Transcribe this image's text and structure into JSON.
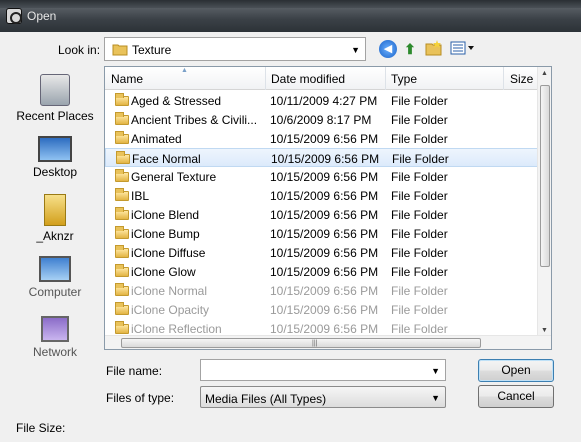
{
  "window": {
    "title": "Open"
  },
  "toolbar": {
    "look_in_label": "Look in:",
    "look_in_value": "Texture",
    "icons": [
      "back-icon",
      "up-folder-icon",
      "new-folder-icon",
      "views-menu-icon"
    ]
  },
  "places": [
    {
      "label": "Recent Places",
      "icon": "recent-places-icon"
    },
    {
      "label": "Desktop",
      "icon": "desktop-icon"
    },
    {
      "label": "_Aknzr",
      "icon": "user-folder-icon"
    },
    {
      "label": "Computer",
      "icon": "computer-icon"
    },
    {
      "label": "Network",
      "icon": "network-icon"
    }
  ],
  "columns": {
    "name": "Name",
    "date": "Date modified",
    "type": "Type",
    "size": "Size"
  },
  "files": [
    {
      "name": "Aged & Stressed",
      "date": "10/11/2009 4:27 PM",
      "type": "File Folder"
    },
    {
      "name": "Ancient Tribes & Civili...",
      "date": "10/6/2009 8:17 PM",
      "type": "File Folder"
    },
    {
      "name": "Animated",
      "date": "10/15/2009 6:56 PM",
      "type": "File Folder"
    },
    {
      "name": "Face Normal",
      "date": "10/15/2009 6:56 PM",
      "type": "File Folder",
      "selected": true
    },
    {
      "name": "General Texture",
      "date": "10/15/2009 6:56 PM",
      "type": "File Folder"
    },
    {
      "name": "IBL",
      "date": "10/15/2009 6:56 PM",
      "type": "File Folder"
    },
    {
      "name": "iClone Blend",
      "date": "10/15/2009 6:56 PM",
      "type": "File Folder"
    },
    {
      "name": "iClone Bump",
      "date": "10/15/2009 6:56 PM",
      "type": "File Folder"
    },
    {
      "name": "iClone Diffuse",
      "date": "10/15/2009 6:56 PM",
      "type": "File Folder"
    },
    {
      "name": "iClone Glow",
      "date": "10/15/2009 6:56 PM",
      "type": "File Folder"
    },
    {
      "name": "iClone Normal",
      "date": "10/15/2009 6:56 PM",
      "type": "File Folder"
    },
    {
      "name": "iClone Opacity",
      "date": "10/15/2009 6:56 PM",
      "type": "File Folder"
    },
    {
      "name": "iClone Reflection",
      "date": "10/15/2009 6:56 PM",
      "type": "File Folder"
    }
  ],
  "form": {
    "file_name_label": "File name:",
    "file_name_value": "",
    "files_of_type_label": "Files of type:",
    "files_of_type_value": "Media Files (All Types)"
  },
  "buttons": {
    "open": "Open",
    "cancel": "Cancel"
  },
  "footer": {
    "file_size_label": "File Size:"
  },
  "colors": {
    "selection": "#dceafb",
    "title_bar": "#3b4147",
    "folder": "#e2b443"
  }
}
